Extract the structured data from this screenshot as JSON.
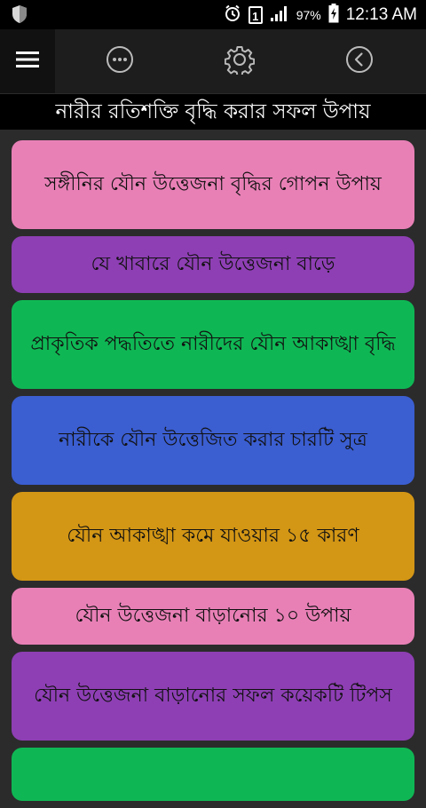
{
  "status_bar": {
    "sim_badge": "1",
    "battery": "97%",
    "time": "12:13 AM"
  },
  "toolbar": {
    "icons": [
      "menu-icon",
      "more-icon",
      "settings-icon",
      "back-icon"
    ]
  },
  "title": "নারীর রতিশক্তি  বৃদ্ধি করার সফল উপায়",
  "items": [
    {
      "label": "সঙ্গীনির যৌন উত্তেজনা বৃদ্ধির গোপন উপায়",
      "color": "#e880b6"
    },
    {
      "label": "যে খাবারে যৌন উত্তেজনা বাড়ে",
      "color": "#8e3fb4"
    },
    {
      "label": "প্রাকৃতিক পদ্ধতিতে নারীদের যৌন আকাঙ্খা বৃদ্ধি",
      "color": "#0fb754"
    },
    {
      "label": "নারীকে যৌন উত্তেজিত করার চারটি সুত্র",
      "color": "#3b5ed1"
    },
    {
      "label": "যৌন আকাঙ্খা কমে যাওয়ার ১৫ কারণ",
      "color": "#d39615"
    },
    {
      "label": "যৌন উত্তেজনা বাড়ানোর ১০ উপায়",
      "color": "#e880b6"
    },
    {
      "label": "যৌন উত্তেজনা বাড়ানোর সফল কয়েকটি টিপস",
      "color": "#8e3fb4"
    },
    {
      "label": "",
      "color": "#0fb754"
    }
  ]
}
